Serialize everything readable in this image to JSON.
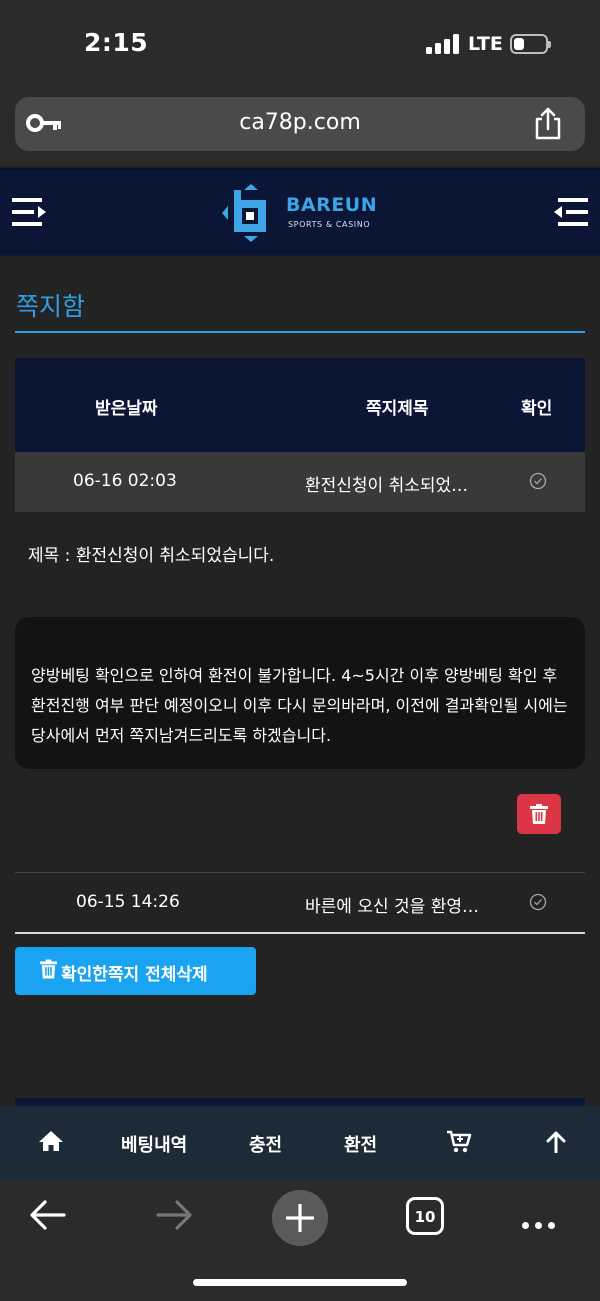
{
  "status": {
    "time": "2:15",
    "network": "LTE"
  },
  "browser": {
    "url": "ca78p.com",
    "tab_count": "10"
  },
  "site": {
    "brand": "BAREUN",
    "tagline": "SPORTS & CASINO"
  },
  "page": {
    "title": "쪽지함"
  },
  "table": {
    "headers": {
      "date": "받은날짜",
      "title": "쪽지제목",
      "confirm": "확인"
    },
    "rows": [
      {
        "date": "06-16 02:03",
        "title": "환전신청이 취소되었…"
      },
      {
        "date": "06-15 14:26",
        "title": "바른에 오신 것을 환영…"
      }
    ]
  },
  "message": {
    "subject": "제목 : 환전신청이 취소되었습니다.",
    "body": "양방베팅 확인으로 인하여 환전이 불가합니다. 4~5시간 이후 양방베팅 확인 후 환전진행 여부 판단 예정이오니 이후 다시 문의바라며, 이전에 결과확인될 시에는 당사에서 먼저 쪽지남겨드리도록 하겠습니다."
  },
  "actions": {
    "delete_read": "확인한쪽지 전체삭제"
  },
  "site_nav": {
    "betting": "베팅내역",
    "deposit": "충전",
    "withdraw": "환전"
  },
  "colors": {
    "accent": "#2e9ee6",
    "header_bg": "#0b1535",
    "danger": "#dc3545",
    "button": "#1aa3f0"
  }
}
